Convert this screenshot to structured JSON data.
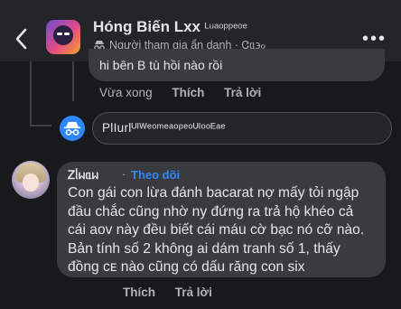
{
  "header": {
    "title": "Hóng Biến Lxx",
    "title_scribble": "ᴸᵘᵃᵒᵖᵖᵉᵒᵉ",
    "subtitle": "Người tham gia ẩn danh",
    "subtitle_scribble": "· Ꮳᥲ϶ℴ",
    "back_icon": "chevron-left-icon",
    "more_icon": "more-horizontal-icon"
  },
  "previous_reply": {
    "text": "hi bên B tù hồi nào rồi",
    "actions": {
      "time": "Vừa xong",
      "like": "Thích",
      "reply": "Trả lời"
    }
  },
  "composer": {
    "avatar_icon": "anonymous-incognito-icon",
    "text": "PlIurlᵁᴵᵂᵉᵒᵐᵉᵃᵒᵖᵉᵒᵁᴵᵒᵒᴱᵃᵉ"
  },
  "comment": {
    "author": "Ꮓᥣᥕᥲᥕ",
    "dot": "·",
    "follow": "Theo dõi",
    "lines": [
      "Con gái con lừa đánh bacarat nợ mấy tỏi ngập",
      "đầu chắc cũng nhờ ny đứng ra trả hộ khéo cả",
      "cái aov này đều biết cái máu cờ bạc nó cỡ nào.",
      "Bản tính số 2 không ai dám tranh số 1, thấy",
      "đồng ᴄᴇ nào cũng có dấu răng con six"
    ],
    "actions": {
      "time": "",
      "like": "Thích",
      "reply": "Trả lời"
    }
  },
  "colors": {
    "background": "#18191a",
    "bubble": "#3a3b3c",
    "text": "#e4e6eb",
    "muted": "#b0b3b8",
    "accent": "#2d88ff"
  }
}
